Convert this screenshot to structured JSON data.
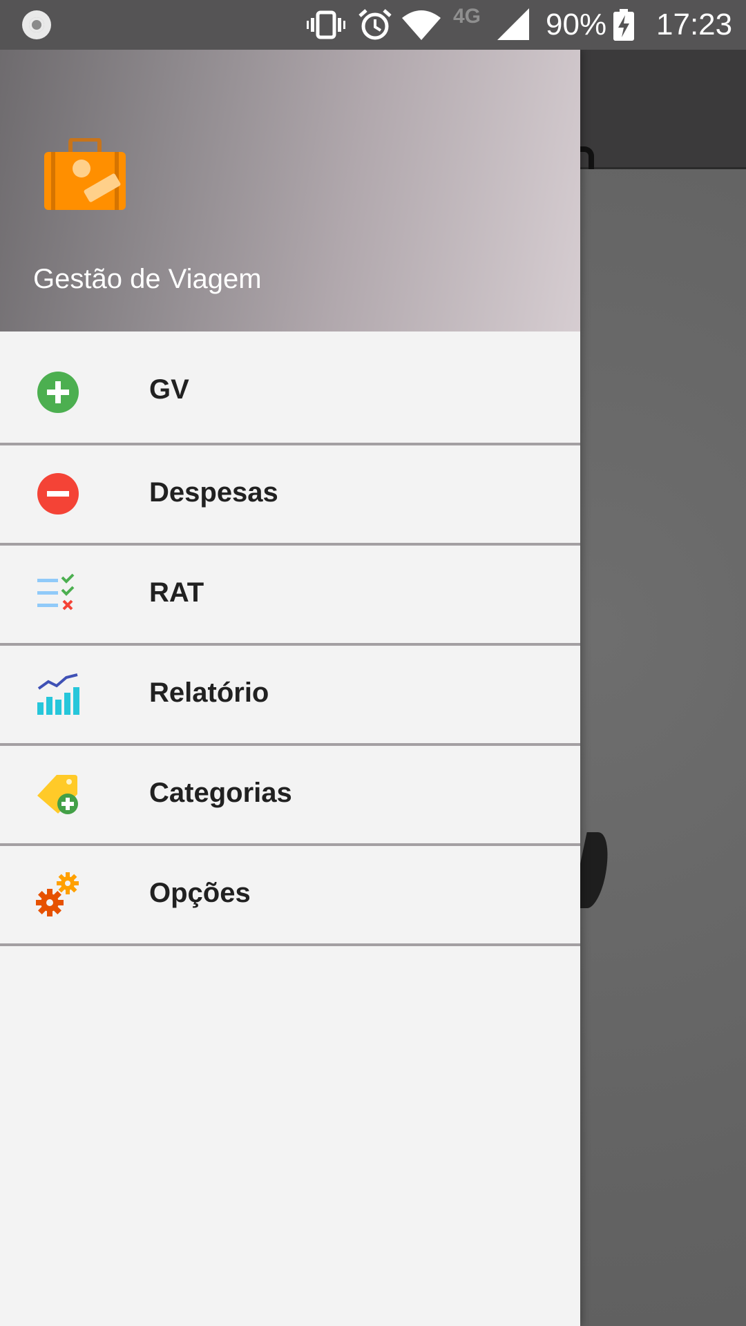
{
  "status_bar": {
    "network_type": "4G",
    "battery_percent": "90%",
    "time": "17:23",
    "icons": [
      "record-icon",
      "vibrate-icon",
      "alarm-icon",
      "wifi-icon",
      "signal-icon",
      "battery-charging-icon"
    ]
  },
  "drawer": {
    "header": {
      "logo_icon": "suitcase-icon",
      "title": "Gestão de Viagem"
    },
    "items": [
      {
        "label": "GV",
        "icon": "add-circle-icon"
      },
      {
        "label": "Despesas",
        "icon": "remove-circle-icon"
      },
      {
        "label": "RAT",
        "icon": "checklist-icon"
      },
      {
        "label": "Relatório",
        "icon": "chart-icon"
      },
      {
        "label": "Categorias",
        "icon": "tag-add-icon"
      },
      {
        "label": "Opções",
        "icon": "gears-icon"
      }
    ]
  },
  "colors": {
    "status_bar": "#555455",
    "drawer_bg": "#f3f3f3",
    "divider": "#a39fa2",
    "green": "#4caf50",
    "red": "#f44336",
    "orange": "#ff8f00"
  }
}
